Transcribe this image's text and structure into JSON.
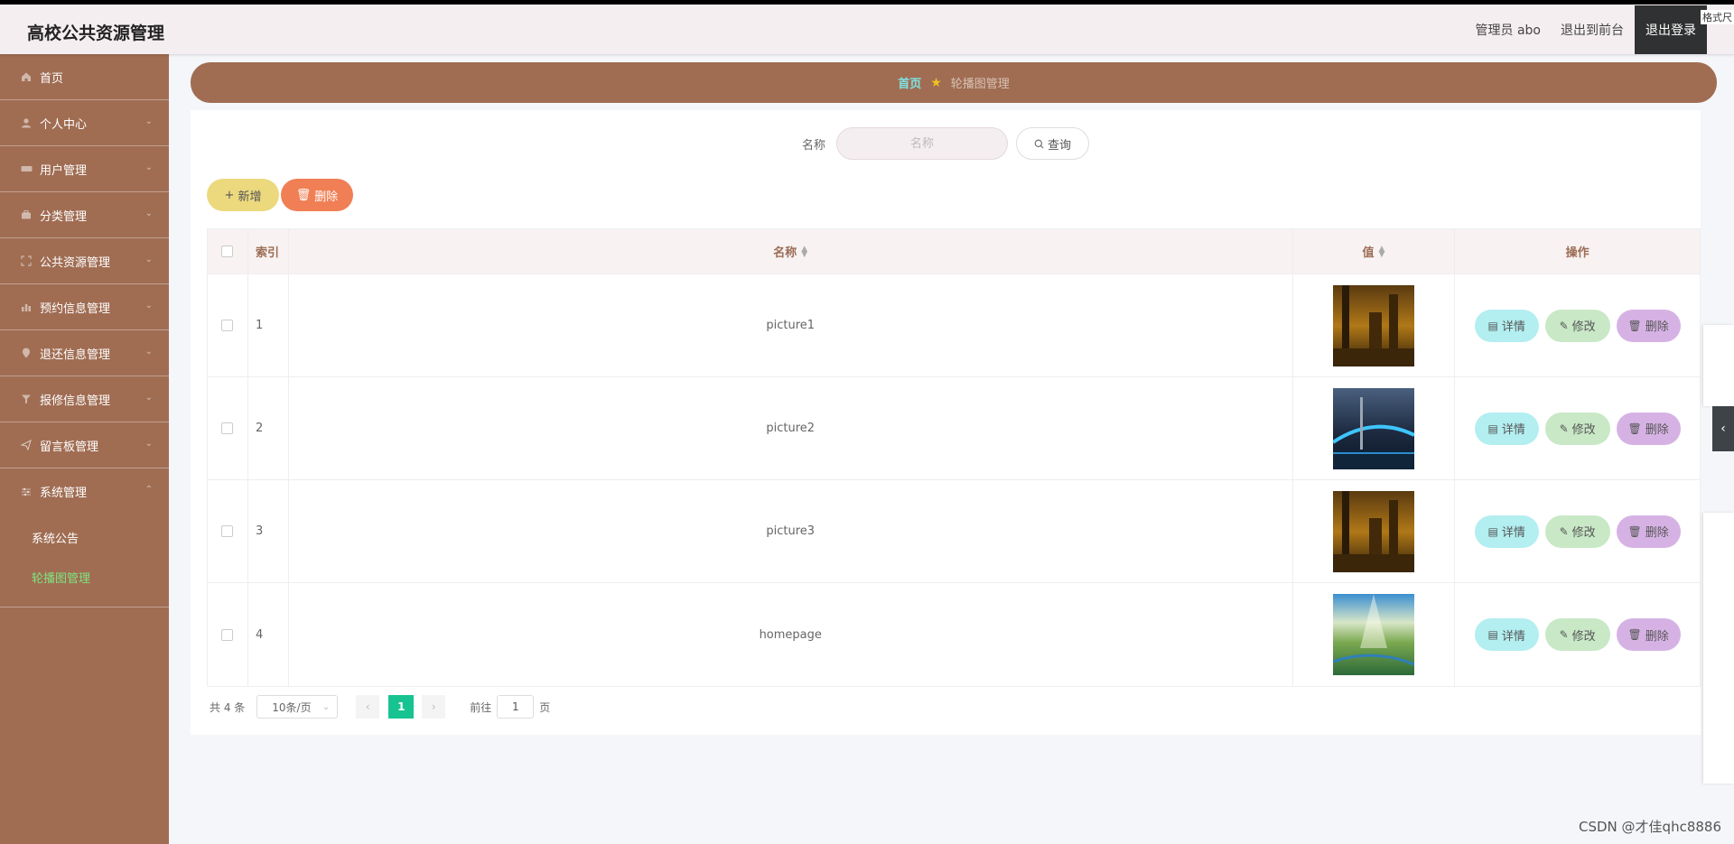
{
  "header": {
    "title": "高校公共资源管理",
    "admin_label": "管理员 abo",
    "front_link": "退出到前台",
    "logout": "退出登录",
    "corner_fragment": "格式尺"
  },
  "sidebar": {
    "items": [
      {
        "label": "首页",
        "icon": "home-icon"
      },
      {
        "label": "个人中心",
        "icon": "user-icon"
      },
      {
        "label": "用户管理",
        "icon": "users-icon"
      },
      {
        "label": "分类管理",
        "icon": "briefcase-icon"
      },
      {
        "label": "公共资源管理",
        "icon": "frame-icon"
      },
      {
        "label": "预约信息管理",
        "icon": "chart-icon"
      },
      {
        "label": "退还信息管理",
        "icon": "pin-icon"
      },
      {
        "label": "报修信息管理",
        "icon": "filter-icon"
      },
      {
        "label": "留言板管理",
        "icon": "send-icon"
      },
      {
        "label": "系统管理",
        "icon": "settings-icon"
      }
    ],
    "sub_items": [
      {
        "label": "系统公告"
      },
      {
        "label": "轮播图管理"
      }
    ]
  },
  "breadcrumb": {
    "home": "首页",
    "current": "轮播图管理"
  },
  "search": {
    "label": "名称",
    "placeholder": "名称",
    "button": "查询"
  },
  "actions": {
    "add": "新增",
    "delete": "删除"
  },
  "table": {
    "columns": [
      "索引",
      "名称",
      "值",
      "操作"
    ],
    "rows": [
      {
        "index": "1",
        "name": "picture1",
        "image": "city-night"
      },
      {
        "index": "2",
        "name": "picture2",
        "image": "bridge-night"
      },
      {
        "index": "3",
        "name": "picture3",
        "image": "city-night"
      },
      {
        "index": "4",
        "name": "homepage",
        "image": "green-landscape"
      }
    ],
    "row_actions": {
      "detail": "详情",
      "edit": "修改",
      "remove": "删除"
    }
  },
  "pagination": {
    "total": "共 4 条",
    "page_size": "10条/页",
    "current_page": "1",
    "goto_label": "前往",
    "goto_value": "1",
    "page_unit": "页"
  },
  "watermark": "CSDN @才佳qhc8886"
}
